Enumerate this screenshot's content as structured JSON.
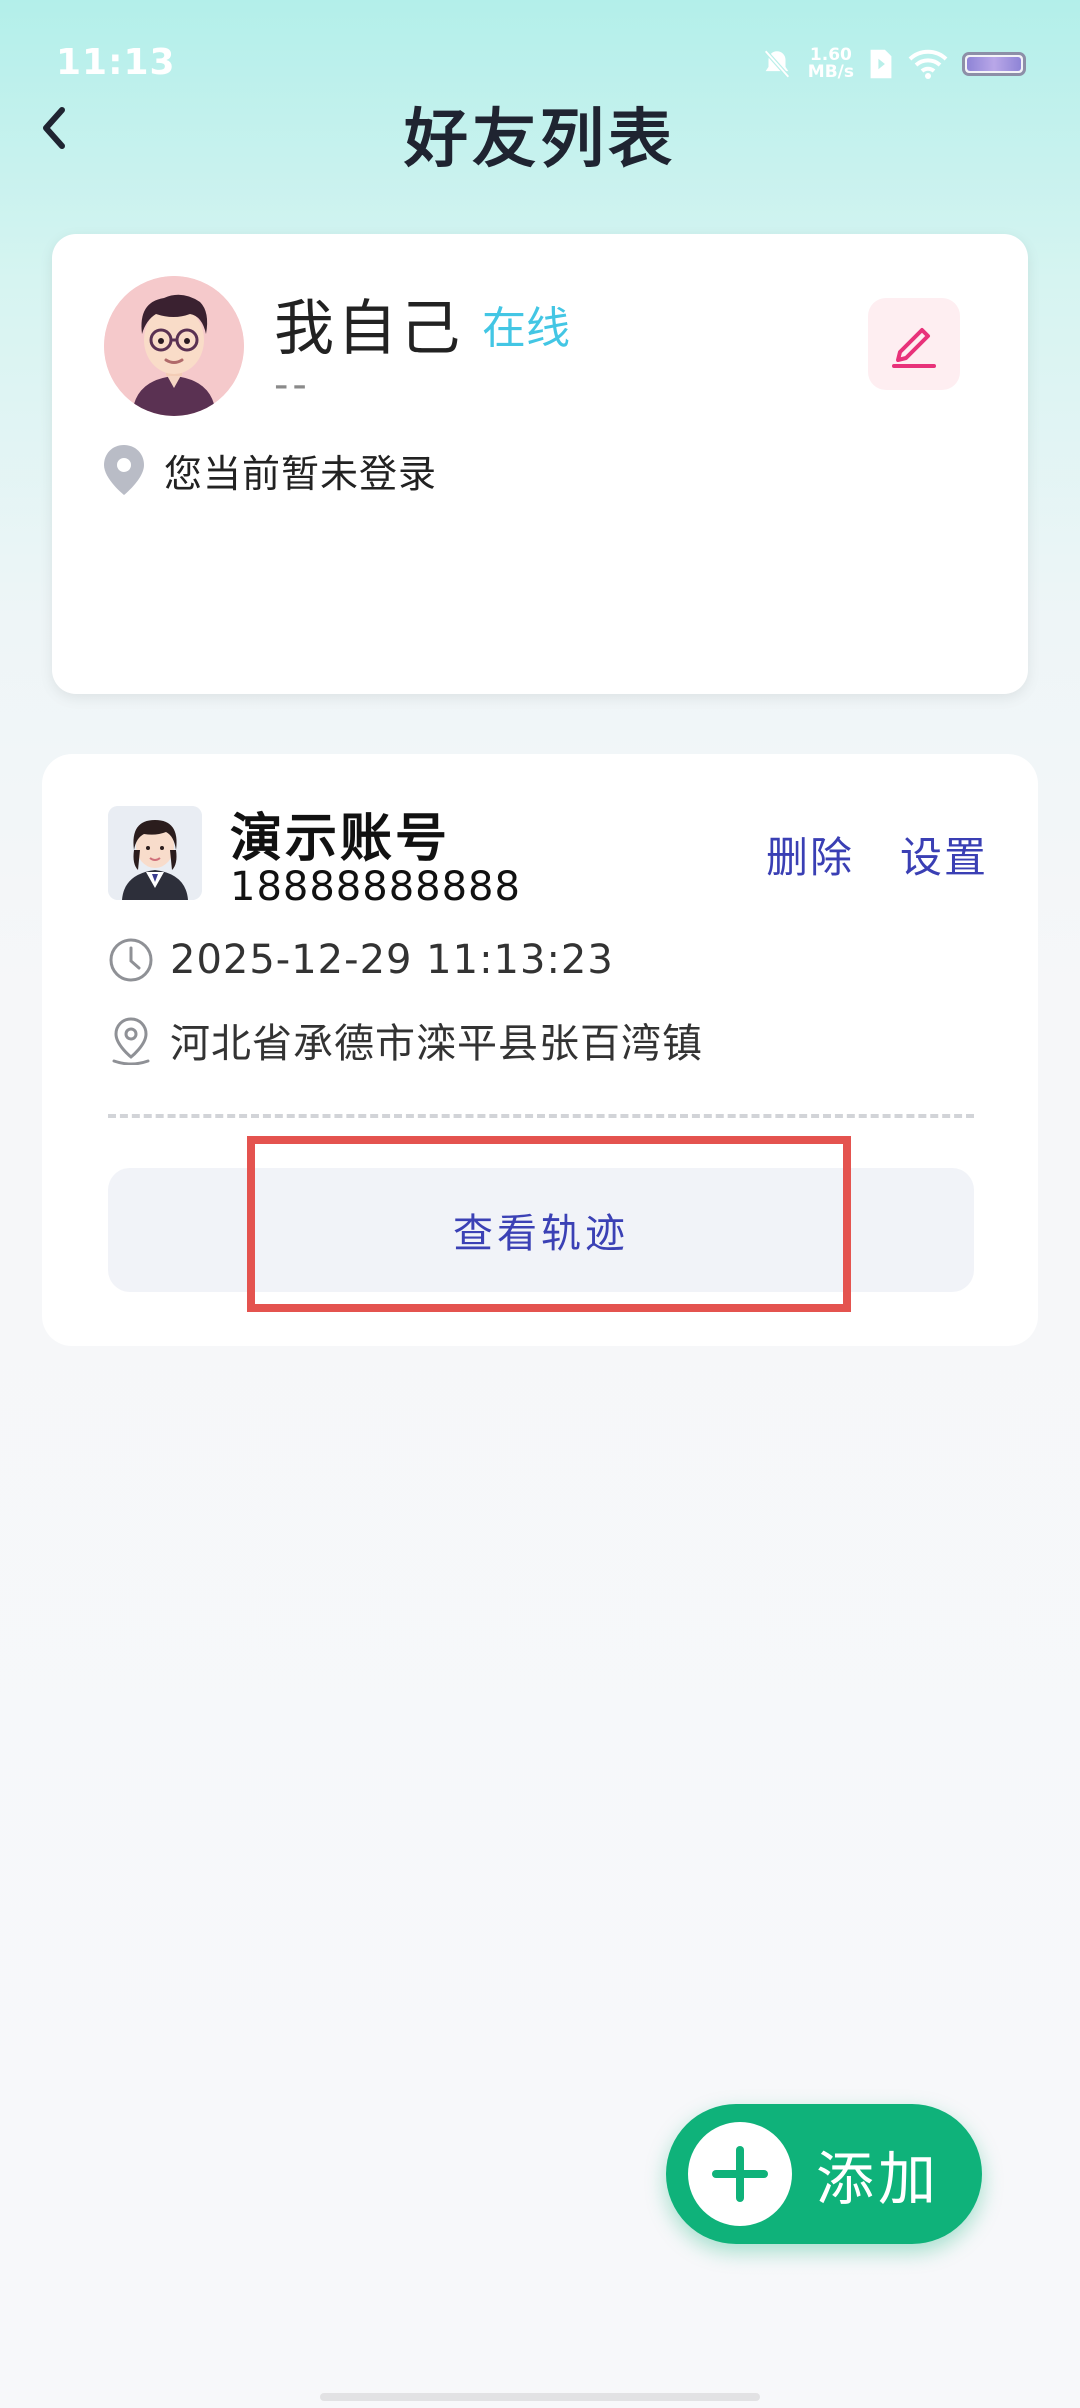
{
  "status_bar": {
    "time": "11:13",
    "net_speed_value": "1.60",
    "net_speed_unit": "MB/s"
  },
  "header": {
    "title": "好友列表"
  },
  "self_card": {
    "name": "我自己",
    "status": "在线",
    "subtitle": "--",
    "location": "您当前暂未登录"
  },
  "friends": [
    {
      "name": "演示账号",
      "phone": "18888888888",
      "time": "2025-12-29 11:13:23",
      "address": "河北省承德市滦平县张百湾镇",
      "delete_label": "删除",
      "settings_label": "设置",
      "track_label": "查看轨迹"
    }
  ],
  "fab": {
    "label": "添加"
  },
  "colors": {
    "accent_blue": "#3a3fb4",
    "online": "#43c6e4",
    "fab_green": "#0fb27a",
    "edit_pink": "#e8327a",
    "highlight_red": "#e4534f"
  }
}
